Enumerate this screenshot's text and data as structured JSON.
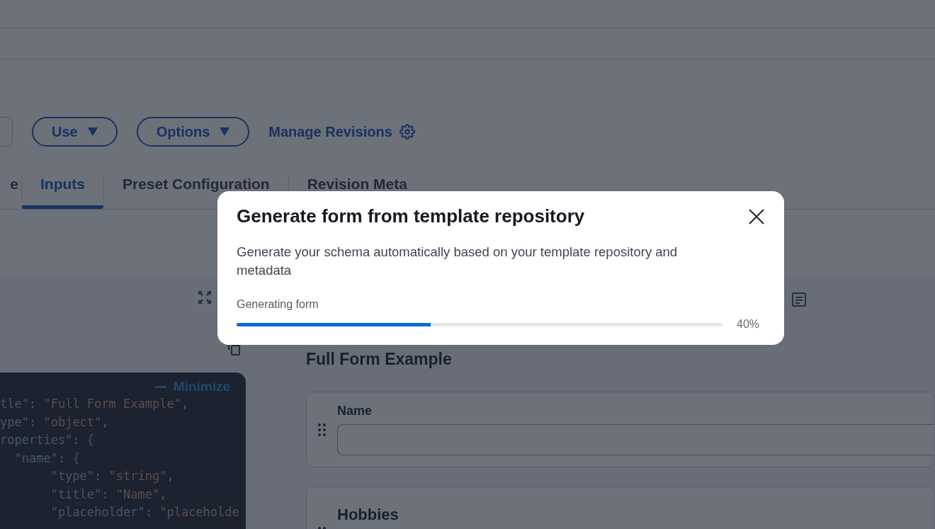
{
  "toolbar": {
    "buttons": [
      {
        "label": "Use"
      },
      {
        "label": "Options"
      }
    ],
    "link": "Manage Revisions"
  },
  "tabs": [
    {
      "label": "e",
      "selected": false
    },
    {
      "label": "Inputs",
      "selected": true
    },
    {
      "label": "Preset Configuration",
      "selected": false
    },
    {
      "label": "Revision Meta",
      "selected": false
    }
  ],
  "editor": {
    "minimize": "Minimize",
    "lines": [
      [
        {
          "kind": "key",
          "text": "tle\""
        },
        {
          "kind": "punct",
          "text": ": "
        },
        {
          "kind": "string",
          "text": "\"Full Form Example\""
        },
        {
          "kind": "punct",
          "text": ","
        }
      ],
      [
        {
          "kind": "key",
          "text": "ype\""
        },
        {
          "kind": "punct",
          "text": ": "
        },
        {
          "kind": "string",
          "text": "\"object\""
        },
        {
          "kind": "punct",
          "text": ","
        }
      ],
      [
        {
          "kind": "key",
          "text": "roperties\""
        },
        {
          "kind": "punct",
          "text": ": "
        },
        {
          "kind": "brace",
          "text": "{"
        }
      ],
      [
        {
          "kind": "key",
          "text": "  \"name\""
        },
        {
          "kind": "punct",
          "text": ": "
        },
        {
          "kind": "brace2",
          "text": "{"
        }
      ],
      [
        {
          "kind": "key",
          "text": "       \"type\""
        },
        {
          "kind": "punct",
          "text": ": "
        },
        {
          "kind": "string",
          "text": "\"string\""
        },
        {
          "kind": "punct",
          "text": ","
        }
      ],
      [
        {
          "kind": "key",
          "text": "       \"title\""
        },
        {
          "kind": "punct",
          "text": ": "
        },
        {
          "kind": "string",
          "text": "\"Name\""
        },
        {
          "kind": "punct",
          "text": ","
        }
      ],
      [
        {
          "kind": "key",
          "text": "       \"placeholder\""
        },
        {
          "kind": "punct",
          "text": ": "
        },
        {
          "kind": "string",
          "text": "\"placeholde"
        }
      ]
    ]
  },
  "form_preview": {
    "title": "Full Form Example",
    "fields": [
      {
        "kind": "text",
        "label": "Name"
      },
      {
        "kind": "group",
        "label": "Hobbies"
      }
    ]
  },
  "dialog": {
    "title": "Generate form from template repository",
    "description": "Generate your schema automatically based on your template repository and metadata",
    "progress": {
      "label": "Generating form",
      "level": 0.4,
      "reading": "40%"
    }
  }
}
